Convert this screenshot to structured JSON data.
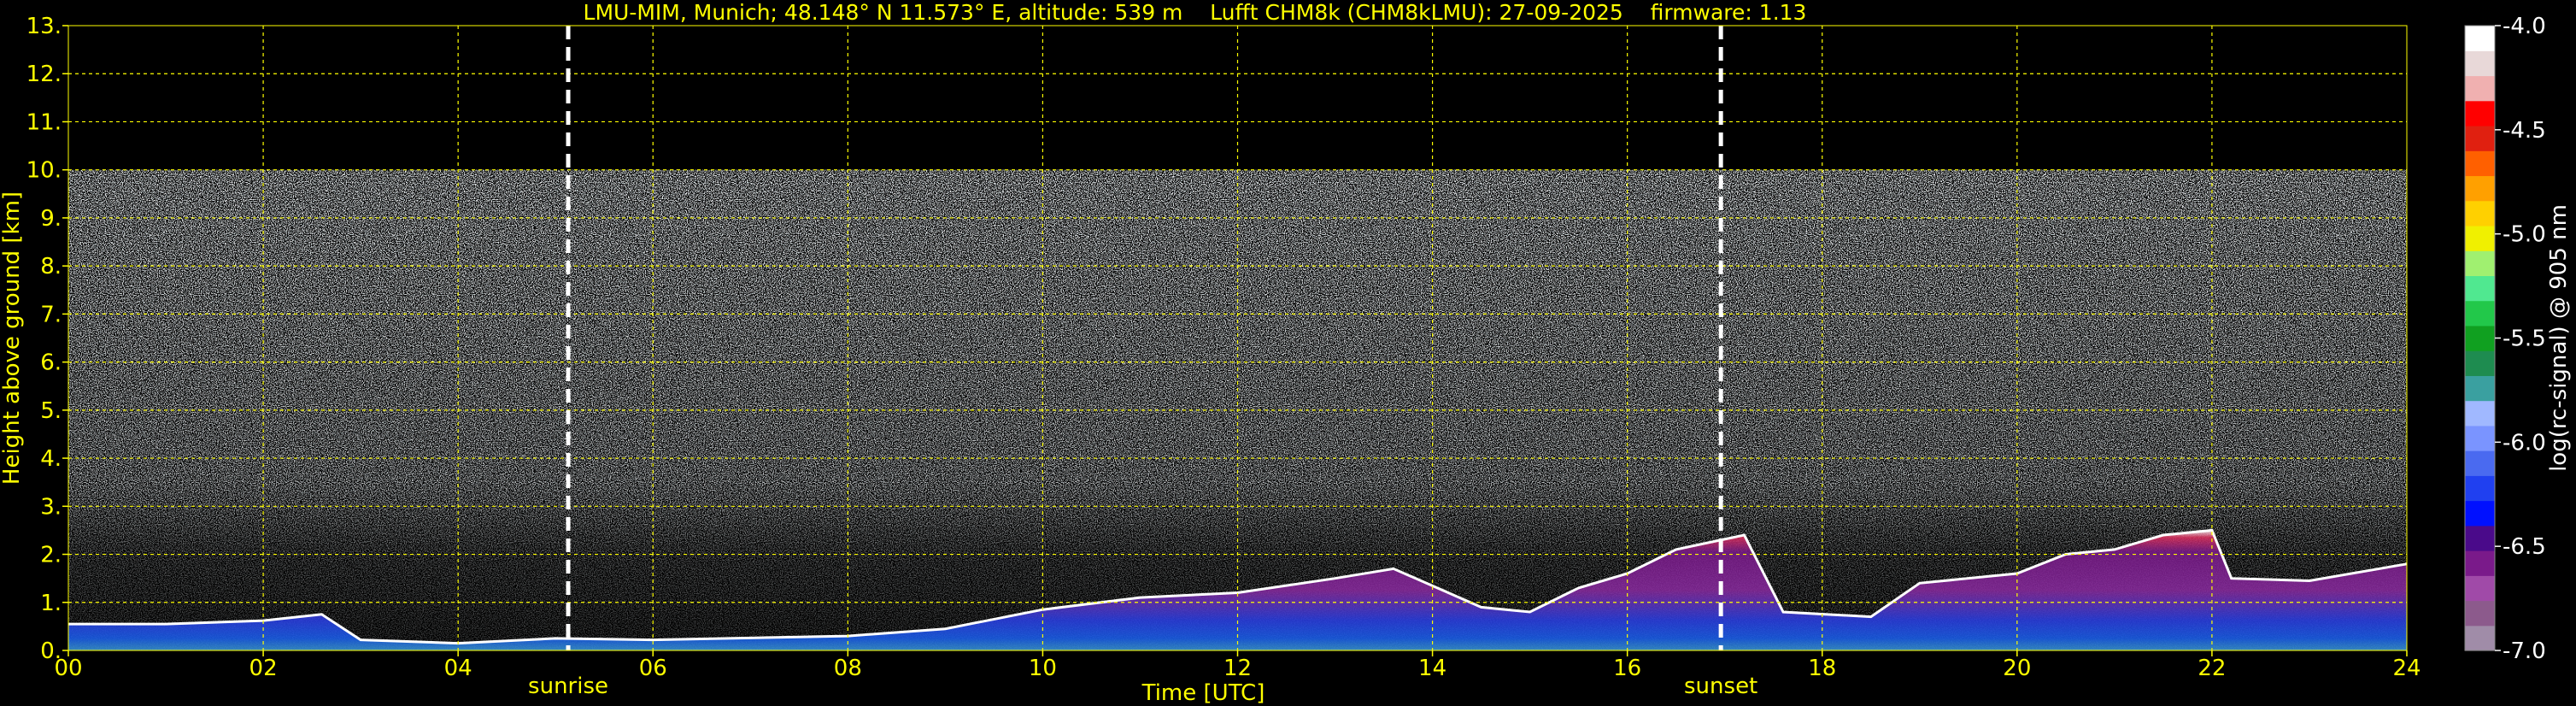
{
  "chart_data": {
    "type": "heatmap",
    "title": "LMU-MIM, Munich; 48.148° N 11.573° E, altitude: 539 m    Lufft CHM8k (CHM8kLMU): 27-09-2025    firmware: 1.13",
    "xlabel": "Time [UTC]",
    "ylabel": "Height above ground [km]",
    "xlim": [
      0,
      24
    ],
    "ylim": [
      0,
      13
    ],
    "x_ticks": [
      "00",
      "02",
      "04",
      "06",
      "08",
      "10",
      "12",
      "14",
      "16",
      "18",
      "20",
      "22",
      "24"
    ],
    "y_ticks": [
      "0.",
      "1.",
      "2.",
      "3.",
      "4.",
      "5.",
      "6.",
      "7.",
      "8.",
      "9.",
      "10.",
      "11.",
      "12.",
      "13."
    ],
    "grid": true,
    "signal_top_km": 10.0,
    "events": [
      {
        "label": "sunrise",
        "time": 5.13
      },
      {
        "label": "sunset",
        "time": 16.96
      }
    ],
    "colorbar": {
      "label": "log(rc-signal) @ 905 nm",
      "range": [
        -7.0,
        -4.0
      ],
      "ticks": [
        "-4.0",
        "-4.5",
        "-5.0",
        "-5.5",
        "-6.0",
        "-6.5",
        "-7.0"
      ],
      "colors": [
        "#a08ca8",
        "#8c5a8c",
        "#a04aa8",
        "#7a1a8a",
        "#4a0a8a",
        "#0010ff",
        "#2040f0",
        "#4a6af0",
        "#7a94ff",
        "#a0b8ff",
        "#3aa0a0",
        "#1e8c50",
        "#10a020",
        "#22c84a",
        "#50e890",
        "#a0f070",
        "#f0f000",
        "#ffd000",
        "#ffa000",
        "#ff6000",
        "#e02010",
        "#ff0000",
        "#f0b0b0",
        "#e8d8d8",
        "#ffffff"
      ]
    },
    "boundary_layer_km": [
      {
        "time": 0.0,
        "height": 0.55
      },
      {
        "time": 1.0,
        "height": 0.55
      },
      {
        "time": 2.0,
        "height": 0.62
      },
      {
        "time": 2.6,
        "height": 0.75
      },
      {
        "time": 3.0,
        "height": 0.22
      },
      {
        "time": 4.0,
        "height": 0.15
      },
      {
        "time": 5.0,
        "height": 0.25
      },
      {
        "time": 6.0,
        "height": 0.22
      },
      {
        "time": 8.0,
        "height": 0.3
      },
      {
        "time": 9.0,
        "height": 0.45
      },
      {
        "time": 10.0,
        "height": 0.85
      },
      {
        "time": 11.0,
        "height": 1.1
      },
      {
        "time": 12.0,
        "height": 1.2
      },
      {
        "time": 13.0,
        "height": 1.5
      },
      {
        "time": 13.6,
        "height": 1.7
      },
      {
        "time": 14.5,
        "height": 0.9
      },
      {
        "time": 15.0,
        "height": 0.8
      },
      {
        "time": 15.5,
        "height": 1.3
      },
      {
        "time": 16.0,
        "height": 1.6
      },
      {
        "time": 16.5,
        "height": 2.1
      },
      {
        "time": 17.2,
        "height": 2.4
      },
      {
        "time": 17.6,
        "height": 0.8
      },
      {
        "time": 18.5,
        "height": 0.7
      },
      {
        "time": 19.0,
        "height": 1.4
      },
      {
        "time": 20.0,
        "height": 1.6
      },
      {
        "time": 20.5,
        "height": 2.0
      },
      {
        "time": 21.0,
        "height": 2.1
      },
      {
        "time": 21.5,
        "height": 2.4
      },
      {
        "time": 22.0,
        "height": 2.5
      },
      {
        "time": 22.2,
        "height": 1.5
      },
      {
        "time": 23.0,
        "height": 1.45
      },
      {
        "time": 24.0,
        "height": 1.8
      }
    ]
  }
}
